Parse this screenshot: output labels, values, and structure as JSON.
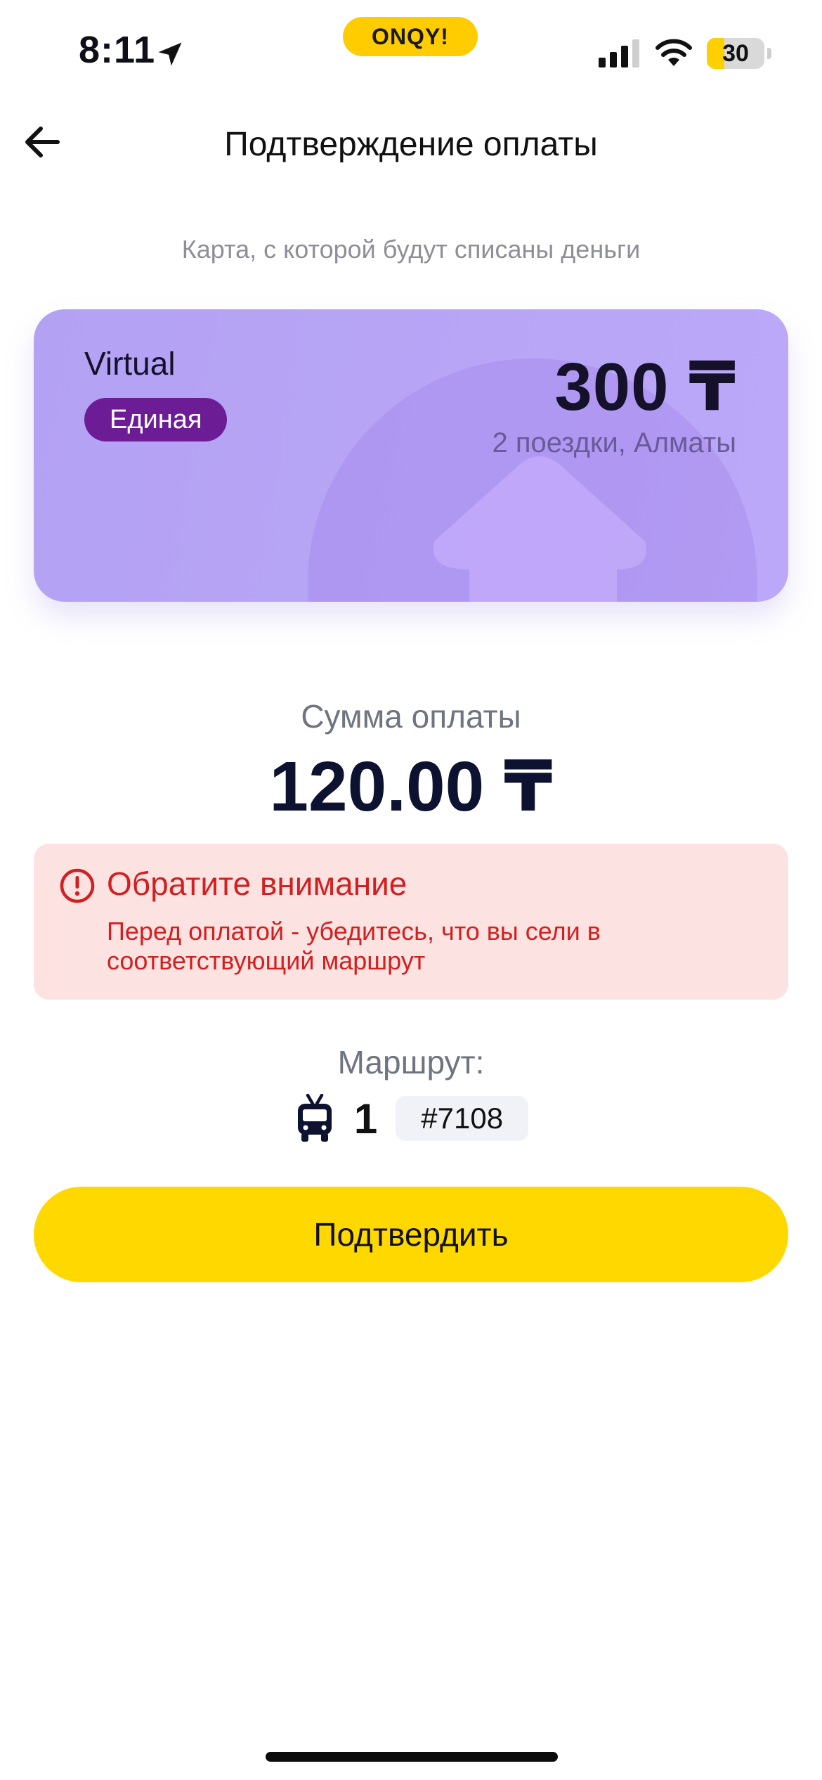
{
  "status_bar": {
    "time": "8:11",
    "app_badge": "ONQY!",
    "battery_level": "30",
    "battery_fraction": 0.3
  },
  "header": {
    "title": "Подтверждение оплаты"
  },
  "card_section": {
    "caption": "Карта, с которой будут списаны деньги",
    "card": {
      "name": "Virtual",
      "type_badge": "Единая",
      "balance": "300 ₸",
      "subtitle": "2 поездки, Алматы"
    }
  },
  "amount": {
    "label": "Сумма оплаты",
    "value": "120.00 ₸"
  },
  "warning": {
    "title": "Обратите внимание",
    "text": "Перед оплатой - убедитесь, что вы сели в соответствующий маршрут"
  },
  "route": {
    "label": "Маршрут:",
    "number": "1",
    "vehicle_id": "#7108",
    "transport_icon": "trolleybus-icon"
  },
  "actions": {
    "confirm_label": "Подтвердить"
  },
  "colors": {
    "accent": "#ffd800",
    "card": "#b3a1f3",
    "badge": "#6c1d96",
    "warning_bg": "#fde2e2",
    "warning_text": "#d21f1f"
  }
}
